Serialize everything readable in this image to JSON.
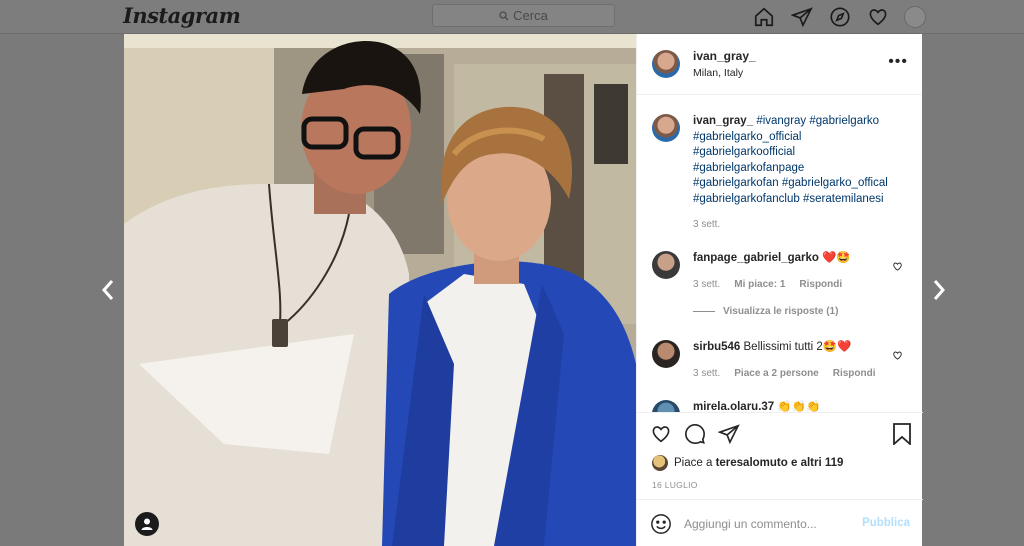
{
  "topbar": {
    "logo": "Instagram",
    "search_placeholder": "Cerca",
    "icons": [
      "home-icon",
      "direct-icon",
      "explore-icon",
      "activity-icon",
      "profile-avatar"
    ]
  },
  "post": {
    "username": "ivan_gray_",
    "location": "Milan, Italy",
    "caption_user": "ivan_gray_",
    "caption_tags": [
      "#ivangray",
      "#gabrielgarko",
      "#gabrielgarko_official",
      "#gabrielgarkoofficial",
      "#gabrielgarkofanpage",
      "#gabrielgarkofan",
      "#gabrielgarko_offical",
      "#gabrielgarkofanclub",
      "#seratemilanesi"
    ],
    "caption_time": "3 sett.",
    "comments": [
      {
        "user": "fanpage_gabriel_garko",
        "text": "❤️🤩",
        "time": "3 sett.",
        "likes": "Mi piace: 1",
        "reply": "Rispondi",
        "view_replies": "Visualizza le risposte (1)"
      },
      {
        "user": "sirbu546",
        "text": "Bellissimi tutti 2🤩❤️",
        "time": "3 sett.",
        "likes": "Piace a 2 persone",
        "reply": "Rispondi"
      },
      {
        "user": "mirela.olaru.37",
        "text": "👏👏👏"
      }
    ],
    "likes_prefix": "Piace a ",
    "likes_user": "teresalomuto",
    "likes_suffix": " e altri 119",
    "date": "16 LUGLIO",
    "comment_placeholder": "Aggiungi un commento...",
    "publish_label": "Pubblica"
  },
  "colors": {
    "link": "#00376b",
    "muted": "#8e8e8e",
    "publish_disabled": "#b2dffc",
    "overlay": "#7a7a7a"
  }
}
